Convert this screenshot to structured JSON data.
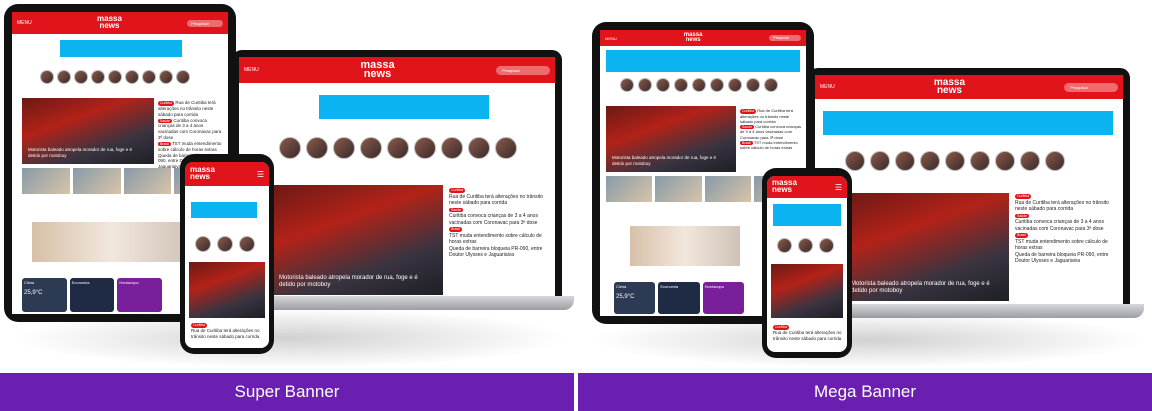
{
  "captions": {
    "left": "Super Banner",
    "right": "Mega Banner"
  },
  "site": {
    "logo_line1": "massa",
    "logo_line2": "news",
    "menu_label": "MENU",
    "search_placeholder": "Pesquisar",
    "hero_headline": "Motorista baleado atropela morador de rua, foge e é detido por motoboy",
    "news_items": [
      {
        "tag": "Curitiba",
        "text": "Rua de Curitiba terá alterações no trânsito neste sábado para corrida"
      },
      {
        "tag": "Saúde",
        "text": "Curitiba convoca crianças de 3 a 4 anos vacinadas com Coronavac para 3ª dose"
      },
      {
        "tag": "Brasil",
        "text": "TST muda entendimento sobre cálculo de horas extras"
      },
      {
        "tag": "",
        "text": "Queda de barreira bloqueia PR-090, entre Doutor Ulysses e Jaguariaiva"
      }
    ],
    "weather_card": "Clima",
    "weather_temp": "25,9°C",
    "economy_card": "Economia",
    "horoscope_card": "Horóscopo"
  },
  "colors": {
    "brand_red": "#e1141b",
    "banner_blue": "#0bb4f0",
    "caption_purple": "#6a1fb0"
  }
}
